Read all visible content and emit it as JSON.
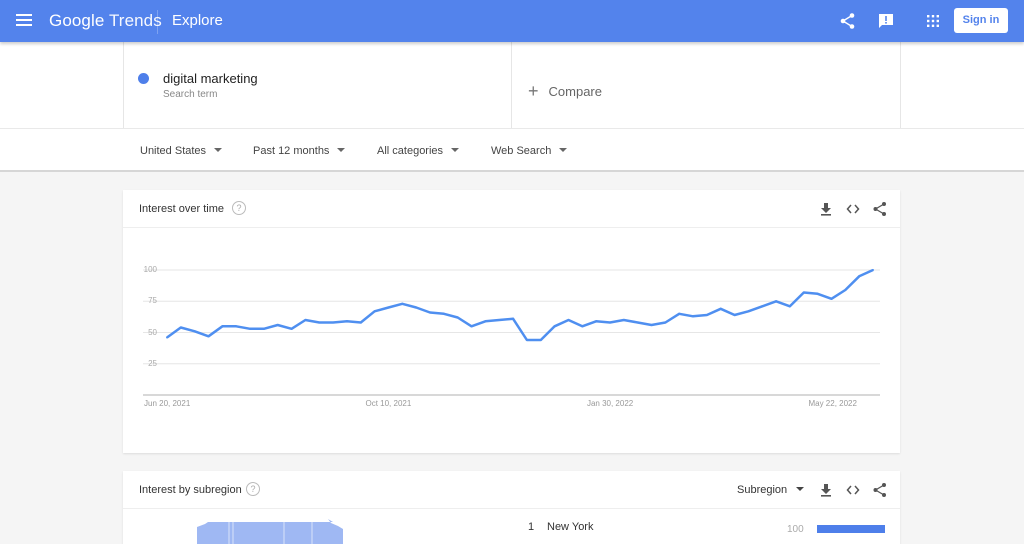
{
  "header": {
    "logo_google": "Google",
    "logo_trends": "Trends",
    "page": "Explore",
    "icons": [
      "menu-icon",
      "share-icon",
      "feedback-icon",
      "apps-grid-icon"
    ],
    "signin_label": "Sign in",
    "brand_color": "#5383ec"
  },
  "search": {
    "term": "digital marketing",
    "term_sublabel": "Search term",
    "term_color": "#4e7fea",
    "compare_label": "Compare"
  },
  "filters": {
    "region": "United States",
    "time": "Past 12 months",
    "category": "All categories",
    "property": "Web Search"
  },
  "interest_over_time": {
    "title": "Interest over time",
    "help": "?",
    "actions": [
      "download-icon",
      "embed-icon",
      "share-icon"
    ]
  },
  "chart_data": {
    "type": "line",
    "title": "Interest over time",
    "xlabel": "",
    "ylabel": "",
    "ylim": [
      0,
      100
    ],
    "yticks": [
      "25",
      "50",
      "75",
      "100"
    ],
    "ytick_values": [
      25,
      50,
      75,
      100
    ],
    "xticks": [
      "Jun 20, 2021",
      "Oct 10, 2021",
      "Jan 30, 2022",
      "May 22, 2022"
    ],
    "xtick_indices": [
      0,
      16,
      32,
      48
    ],
    "grid": true,
    "series": [
      {
        "name": "digital marketing",
        "color": "#4f8ff0",
        "values": [
          46,
          54,
          51,
          47,
          55,
          55,
          53,
          53,
          56,
          53,
          60,
          58,
          58,
          59,
          58,
          67,
          70,
          73,
          70,
          66,
          65,
          62,
          55,
          59,
          60,
          61,
          44,
          44,
          55,
          60,
          55,
          59,
          58,
          60,
          58,
          56,
          58,
          65,
          63,
          64,
          69,
          64,
          67,
          71,
          75,
          71,
          82,
          81,
          77,
          84,
          95,
          100
        ]
      }
    ]
  },
  "interest_by_subregion": {
    "title": "Interest by subregion",
    "help": "?",
    "resolution_select": "Subregion",
    "actions": [
      "download-icon",
      "embed-icon",
      "share-icon"
    ],
    "rows": [
      {
        "rank": "1",
        "name": "New York",
        "value": "100",
        "fraction": 1.0
      }
    ]
  }
}
